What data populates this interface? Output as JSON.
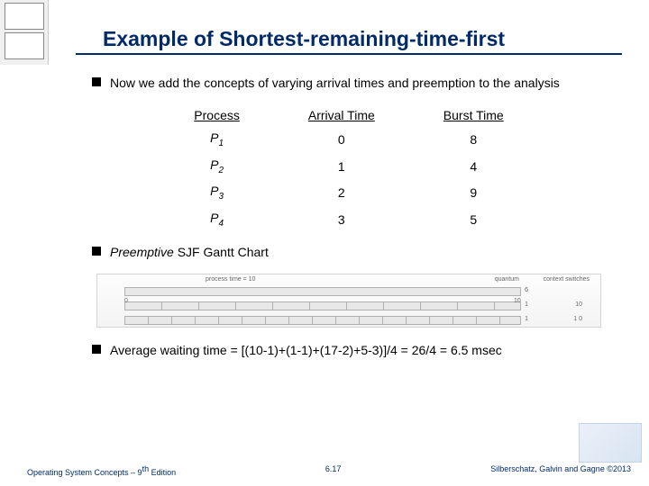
{
  "title": "Example of Shortest-remaining-time-first",
  "bullets": {
    "b1": "Now we add the concepts of varying arrival times and preemption to the analysis",
    "b2_prefix": "Preemptive",
    "b2_rest": " SJF Gantt Chart",
    "b3": "Average waiting time = [(10-1)+(1-1)+(17-2)+5-3)]/4 = 26/4 = 6.5 msec"
  },
  "table": {
    "headers": {
      "c1": "Process",
      "c2": "Arrival Time",
      "c3": "Burst Time"
    },
    "rows": [
      {
        "p": "P",
        "n": "1",
        "arrival": "0",
        "burst": "8"
      },
      {
        "p": "P",
        "n": "2",
        "arrival": "1",
        "burst": "4"
      },
      {
        "p": "P",
        "n": "3",
        "arrival": "2",
        "burst": "9"
      },
      {
        "p": "P",
        "n": "4",
        "arrival": "3",
        "burst": "5"
      }
    ]
  },
  "gantt": {
    "top_label": "process time = 10",
    "quantum_label": "quantum",
    "cs_label": "context switches",
    "ticks": [
      "0",
      "0",
      "0",
      "10"
    ],
    "right_vals": [
      "6",
      "1",
      "1",
      "10",
      "1 0"
    ]
  },
  "footer": {
    "left_a": "Operating System Concepts – 9",
    "left_b": " Edition",
    "left_sup": "th",
    "center": "6.17",
    "right": "Silberschatz, Galvin and Gagne ©2013"
  }
}
